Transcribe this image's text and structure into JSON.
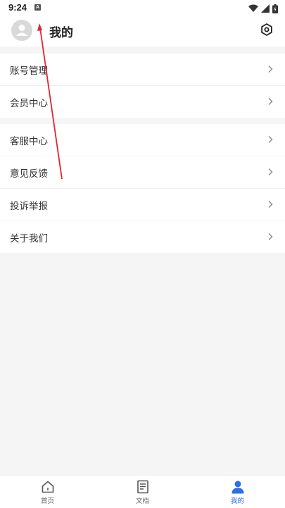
{
  "status_bar": {
    "time": "9:24",
    "notification_icon": "A"
  },
  "header": {
    "title": "我的"
  },
  "menu_groups": [
    {
      "items": [
        {
          "label": "账号管理"
        },
        {
          "label": "会员中心"
        }
      ]
    },
    {
      "items": [
        {
          "label": "客服中心"
        },
        {
          "label": "意见反馈"
        },
        {
          "label": "投诉举报"
        },
        {
          "label": "关于我们"
        }
      ]
    }
  ],
  "tabbar": {
    "tabs": [
      {
        "label": "首页"
      },
      {
        "label": "文档"
      },
      {
        "label": "我的"
      }
    ],
    "active_color": "#2e6ee6"
  },
  "icons": [
    "wifi-icon",
    "signal-icon",
    "battery-icon",
    "avatar-icon",
    "settings-icon",
    "chevron-right-icon",
    "home-icon",
    "document-icon",
    "user-icon"
  ]
}
